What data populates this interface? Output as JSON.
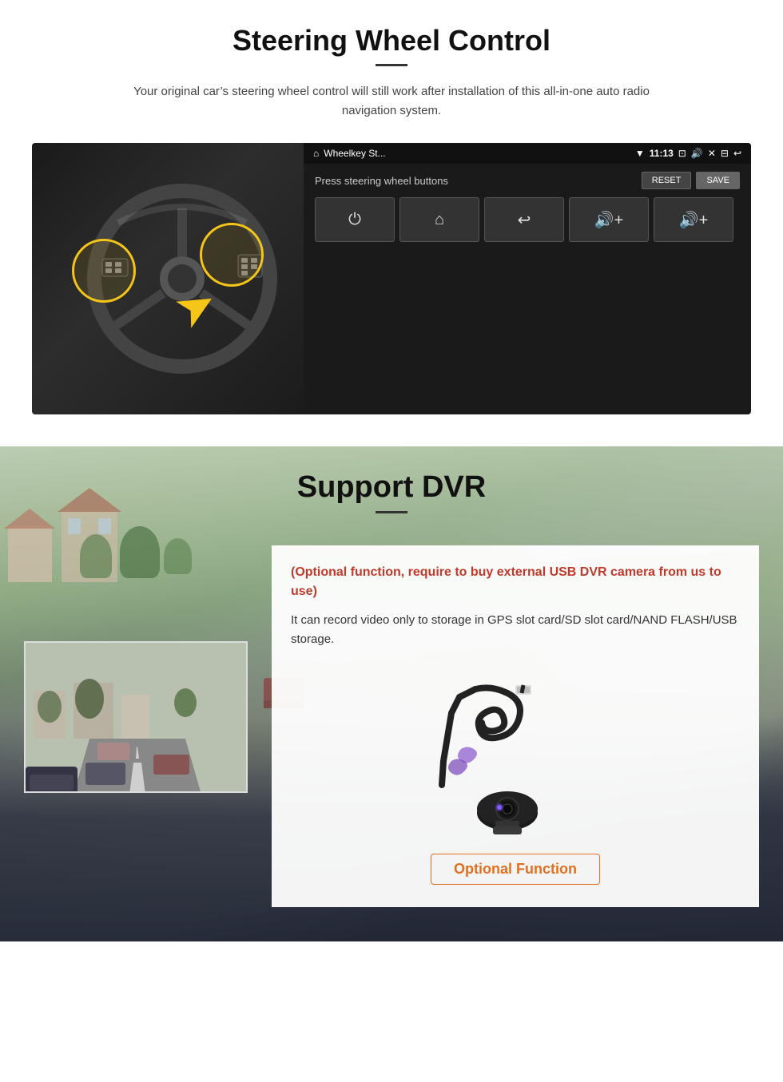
{
  "steering": {
    "title": "Steering Wheel Control",
    "subtitle": "Your original car’s steering wheel control will still work after installation of this all-in-one auto radio navigation system.",
    "android_app_name": "Wheelkey St...",
    "android_time": "11:13",
    "android_instruction": "Press steering wheel buttons",
    "reset_label": "RESET",
    "save_label": "SAVE",
    "grid_icons": [
      "⏻",
      "⌂",
      "↩",
      "🔊+",
      "🔊+"
    ]
  },
  "dvr": {
    "title": "Support DVR",
    "optional_note": "(Optional function, require to buy external USB DVR camera from us to use)",
    "description": "It can record video only to storage in GPS slot card/SD slot card/NAND FLASH/USB storage.",
    "optional_function_label": "Optional Function"
  }
}
